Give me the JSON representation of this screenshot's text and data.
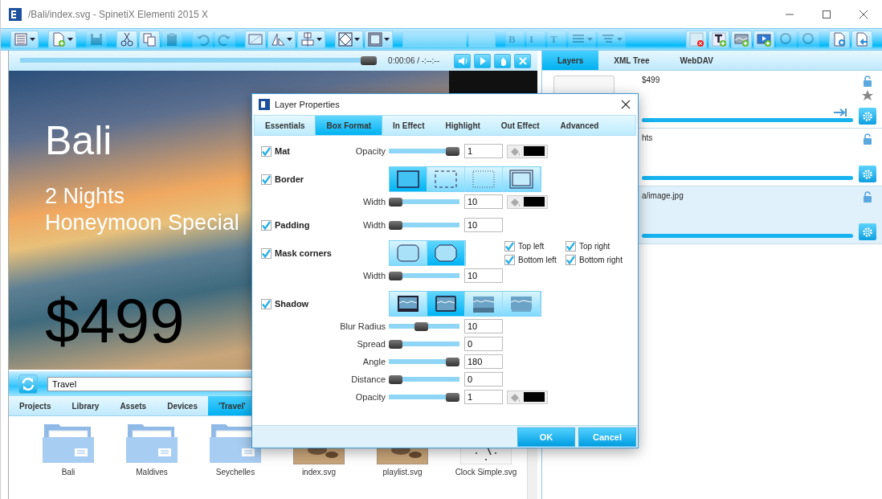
{
  "window": {
    "title": "/Bali/index.svg - SpinetiX Elementi 2015 X"
  },
  "toolbar": {
    "left_groups": [
      [
        {
          "kind": "button",
          "disabled": false,
          "dropdown": true
        }
      ],
      [
        {
          "kind": "button",
          "disabled": false,
          "dropdown": true
        }
      ],
      [
        {
          "kind": "button",
          "disabled": true,
          "dropdown": false
        }
      ],
      [
        {
          "kind": "button",
          "disabled": false,
          "dropdown": false
        },
        {
          "kind": "button",
          "disabled": false,
          "dropdown": false
        },
        {
          "kind": "button",
          "disabled": true,
          "dropdown": false
        }
      ],
      [
        {
          "kind": "button",
          "disabled": true,
          "dropdown": false
        },
        {
          "kind": "button",
          "disabled": true,
          "dropdown": false
        }
      ],
      [
        {
          "kind": "button",
          "disabled": false,
          "dropdown": false
        },
        {
          "kind": "button",
          "disabled": false,
          "dropdown": true
        },
        {
          "kind": "button",
          "disabled": false,
          "dropdown": true
        }
      ],
      [
        {
          "kind": "button",
          "disabled": false,
          "dropdown": true
        },
        {
          "kind": "button",
          "disabled": false,
          "dropdown": true
        }
      ],
      [
        {
          "kind": "combo",
          "disabled": true
        },
        {
          "kind": "combo",
          "disabled": true
        }
      ],
      [
        {
          "kind": "text",
          "label": "B",
          "disabled": true
        },
        {
          "kind": "text",
          "label": "I",
          "disabled": true
        },
        {
          "kind": "text",
          "label": "T",
          "disabled": true
        },
        {
          "kind": "button",
          "disabled": true,
          "dropdown": true
        },
        {
          "kind": "button",
          "disabled": true,
          "dropdown": true
        }
      ]
    ],
    "right_groups": [
      [
        {
          "kind": "button",
          "disabled": false,
          "dropdown": false
        },
        {
          "kind": "button",
          "disabled": false,
          "dropdown": false
        },
        {
          "kind": "button",
          "disabled": false,
          "dropdown": false
        },
        {
          "kind": "button",
          "disabled": false,
          "dropdown": false
        },
        {
          "kind": "button",
          "disabled": true,
          "dropdown": false
        },
        {
          "kind": "button",
          "disabled": true,
          "dropdown": false
        }
      ],
      [
        {
          "kind": "button",
          "disabled": false,
          "dropdown": false
        },
        {
          "kind": "button",
          "disabled": false,
          "dropdown": false
        }
      ]
    ]
  },
  "player": {
    "level": 1,
    "time": "0:00:06 / -:--:--"
  },
  "preview": {
    "texts": [
      {
        "kind": "title",
        "text": "Bali"
      },
      {
        "kind": "subtitle",
        "text": "2 Nights"
      },
      {
        "kind": "subtitle",
        "text": "Honeymoon Special"
      },
      {
        "kind": "price",
        "text": "$499"
      }
    ]
  },
  "path": {
    "value": "Travel"
  },
  "browser_tabs": [
    {
      "label": "Projects",
      "selected": false
    },
    {
      "label": "Library",
      "selected": false
    },
    {
      "label": "Assets",
      "selected": false
    },
    {
      "label": "Devices",
      "selected": false
    },
    {
      "label": "'Travel'",
      "selected": true
    }
  ],
  "files": [
    {
      "kind": "folder",
      "name": "Bali"
    },
    {
      "kind": "folder",
      "name": "Maldives"
    },
    {
      "kind": "folder",
      "name": "Seychelles"
    },
    {
      "kind": "image",
      "name": "index.svg"
    },
    {
      "kind": "image",
      "name": "playlist.svg"
    },
    {
      "kind": "clock",
      "name": "Clock Simple.svg"
    }
  ],
  "side_tabs": [
    {
      "label": "Layers",
      "selected": true
    },
    {
      "label": "XML Tree",
      "selected": false
    },
    {
      "label": "WebDAV",
      "selected": false
    }
  ],
  "layers": [
    {
      "name": "$499",
      "selected": false,
      "thumbnail": true,
      "starred": true,
      "linked": true
    },
    {
      "name": "hts",
      "selected": false,
      "starred": false,
      "linked": false
    },
    {
      "name": "a/image.jpg",
      "selected": true,
      "starred": false,
      "linked": false
    }
  ],
  "dialog": {
    "title": "Layer Properties",
    "tabs": [
      {
        "label": "Essentials",
        "selected": false
      },
      {
        "label": "Box Format",
        "selected": true
      },
      {
        "label": "In Effect",
        "selected": false
      },
      {
        "label": "Highlight",
        "selected": false
      },
      {
        "label": "Out Effect",
        "selected": false
      },
      {
        "label": "Advanced",
        "selected": false
      }
    ],
    "rows": [
      {
        "kind": "slider",
        "check": {
          "label": "Mat",
          "checked": true
        },
        "label": "Opacity",
        "level": 1,
        "value": "1",
        "color": "#000000"
      },
      {
        "kind": "segments",
        "check": {
          "label": "Border",
          "checked": true
        },
        "options": [
          {
            "kind": "solid",
            "selected": true
          },
          {
            "kind": "dashed",
            "selected": false
          },
          {
            "kind": "dotted",
            "selected": false
          },
          {
            "kind": "double",
            "selected": false
          }
        ]
      },
      {
        "kind": "slider",
        "label": "Width",
        "level": 0,
        "value": "10",
        "color": "#000000"
      },
      {
        "kind": "slider",
        "check": {
          "label": "Padding",
          "checked": true
        },
        "label": "Width",
        "level": 0,
        "value": "10"
      },
      {
        "kind": "segments",
        "check": {
          "label": "Mask corners",
          "checked": true
        },
        "options": [
          {
            "kind": "rounded",
            "selected": false
          },
          {
            "kind": "chamfered",
            "selected": true
          }
        ],
        "corners": [
          {
            "label": "Top left",
            "checked": true
          },
          {
            "label": "Top right",
            "checked": true
          },
          {
            "label": "Bottom left",
            "checked": true
          },
          {
            "label": "Bottom right",
            "checked": true
          }
        ]
      },
      {
        "kind": "slider",
        "label": "Width",
        "level": 0,
        "value": "10"
      },
      {
        "kind": "segments",
        "check": {
          "label": "Shadow",
          "checked": true
        },
        "options": [
          {
            "kind": "shadow-outer",
            "selected": false
          },
          {
            "kind": "shadow-inner",
            "selected": true
          },
          {
            "kind": "shadow-bottom",
            "selected": false
          },
          {
            "kind": "shadow-soft",
            "selected": false
          }
        ]
      },
      {
        "kind": "slider",
        "label": "Blur Radius",
        "level": 0.45,
        "value": "10"
      },
      {
        "kind": "slider",
        "label": "Spread",
        "level": 0,
        "value": "0"
      },
      {
        "kind": "slider",
        "label": "Angle",
        "level": 1,
        "value": "180"
      },
      {
        "kind": "slider",
        "label": "Distance",
        "level": 0,
        "value": "0"
      },
      {
        "kind": "slider",
        "label": "Opacity",
        "level": 1,
        "value": "1",
        "color": "#000000"
      }
    ],
    "buttons": [
      "OK",
      "Cancel"
    ]
  }
}
